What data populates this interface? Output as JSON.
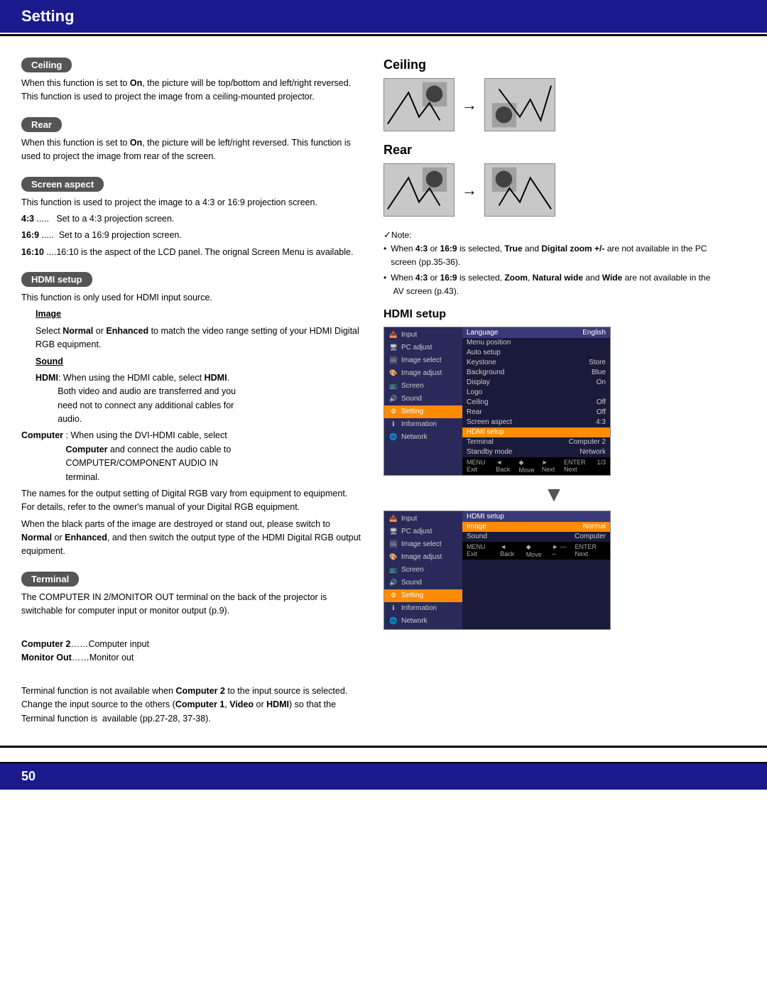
{
  "header": {
    "title": "Setting",
    "page_number": "50"
  },
  "left": {
    "sections": [
      {
        "id": "ceiling",
        "label": "Ceiling",
        "text": "When this function is set to On, the picture will be top/bottom and left/right reversed. This function is used to project the image from a ceiling-mounted projector."
      },
      {
        "id": "rear",
        "label": "Rear",
        "text": "When this function is set to On, the picture will be left/right reversed. This function is used to project the image from rear of the screen."
      },
      {
        "id": "screen_aspect",
        "label": "Screen aspect",
        "text": "This function is used to project the image to a 4:3 or 16:9 projection screen.",
        "items": [
          {
            "prefix": "4:3 .....",
            "text": "Set to a 4:3 projection screen."
          },
          {
            "prefix": "16:9 .....",
            "text": "Set to a 16:9 projection screen."
          },
          {
            "prefix": "16:10 ....",
            "text": "16:10 is the aspect of the LCD panel. The orignal Screen Menu is available."
          }
        ]
      },
      {
        "id": "hdmi_setup",
        "label": "HDMI setup",
        "intro": "This function is only used for HDMI input source.",
        "sub": [
          {
            "name": "Image",
            "text": "Select Normal or Enhanced to match the video range setting of your HDMI Digital RGB equipment."
          },
          {
            "name": "Sound",
            "items": [
              {
                "prefix": "HDMI:",
                "text": "When using the HDMI cable, select HDMI. Both video and audio are transferred and you need not to connect any additional cables for audio."
              },
              {
                "prefix": "Computer :",
                "text": "When using the DVI-HDMI cable, select Computer and connect the audio cable to COMPUTER/COMPONENT AUDIO IN terminal."
              }
            ]
          }
        ],
        "notes": [
          "The names for the output setting of Digital RGB vary from equipment to equipment. For details, refer to the owner's manual of your Digital RGB equipment.",
          "When the black parts of the image are destroyed or stand out, please switch to Normal or Enhanced, and then switch the output type of the HDMI Digital RGB output equipment."
        ]
      },
      {
        "id": "terminal",
        "label": "Terminal",
        "text": "The COMPUTER IN 2/MONITOR OUT terminal on the back of the projector is switchable for computer input or monitor output (p.9).",
        "items": [
          {
            "prefix": "Computer 2……",
            "text": "Computer input"
          },
          {
            "prefix": "Monitor Out……",
            "text": "Monitor out"
          }
        ],
        "note": "Terminal function is not available when Computer 2 to the input source is selected. Change the input source to the others (Computer 1, Video or HDMI) so that the Terminal function is  available (pp.27-28, 37-38)."
      }
    ]
  },
  "right": {
    "ceiling_heading": "Ceiling",
    "rear_heading": "Rear",
    "hdmi_heading": "HDMI setup",
    "note_check": "✓Note:",
    "notes": [
      {
        "text": "When 4:3 or 16:9 is selected, True and Digital zoom +/- are not available in the PC screen (pp.35-36)."
      },
      {
        "text": "When 4:3 or 16:9 is selected, Zoom, Natural wide and Wide are not available in the  AV screen (p.43)."
      }
    ],
    "menu1": {
      "left_items": [
        {
          "label": "Input",
          "icon": "📥",
          "active": false
        },
        {
          "label": "PC adjust",
          "icon": "🖥",
          "active": false
        },
        {
          "label": "Image select",
          "icon": "🖼",
          "active": false
        },
        {
          "label": "Image adjust",
          "icon": "🎨",
          "active": false
        },
        {
          "label": "Screen",
          "icon": "📺",
          "active": false
        },
        {
          "label": "Sound",
          "icon": "🔊",
          "active": false
        },
        {
          "label": "Setting",
          "icon": "⚙",
          "active": true
        },
        {
          "label": "Information",
          "icon": "ℹ",
          "active": false
        },
        {
          "label": "Network",
          "icon": "🌐",
          "active": false
        }
      ],
      "right_header": "Language",
      "right_items": [
        {
          "label": "Language",
          "value": "English"
        },
        {
          "label": "Menu position",
          "value": ""
        },
        {
          "label": "Auto setup",
          "value": ""
        },
        {
          "label": "Keystone",
          "value": "Store"
        },
        {
          "label": "Background",
          "value": "Blue"
        },
        {
          "label": "Display",
          "value": "On"
        },
        {
          "label": "Logo",
          "value": ""
        },
        {
          "label": "Ceiling",
          "value": "Off"
        },
        {
          "label": "Rear",
          "value": "Off"
        },
        {
          "label": "Screen aspect",
          "value": "4:3"
        },
        {
          "label": "HDMI setup",
          "value": "",
          "highlight": true
        },
        {
          "label": "Terminal",
          "value": "Computer 2"
        },
        {
          "label": "Standby mode",
          "value": "Network"
        }
      ],
      "page_info": "1/3",
      "bottom_bar": [
        "MENU Exit",
        "◄ Back",
        "◆ Move",
        "► Next",
        "ENTER Next"
      ]
    },
    "menu2": {
      "left_items": [
        {
          "label": "Input",
          "icon": "📥"
        },
        {
          "label": "PC adjust",
          "icon": "🖥"
        },
        {
          "label": "Image select",
          "icon": "🖼"
        },
        {
          "label": "Image adjust",
          "icon": "🎨"
        },
        {
          "label": "Screen",
          "icon": "📺"
        },
        {
          "label": "Sound",
          "icon": "🔊"
        },
        {
          "label": "Setting",
          "icon": "⚙",
          "active": true
        },
        {
          "label": "Information",
          "icon": "ℹ"
        },
        {
          "label": "Network",
          "icon": "🌐"
        }
      ],
      "right_header": "HDMI setup",
      "right_items": [
        {
          "label": "Image",
          "value": "Normal",
          "highlight": true
        },
        {
          "label": "Sound",
          "value": "Computer"
        }
      ],
      "bottom_bar": [
        "MENU Exit",
        "◄ Back",
        "◆ Move",
        "► -----",
        "ENTER Next"
      ]
    }
  }
}
